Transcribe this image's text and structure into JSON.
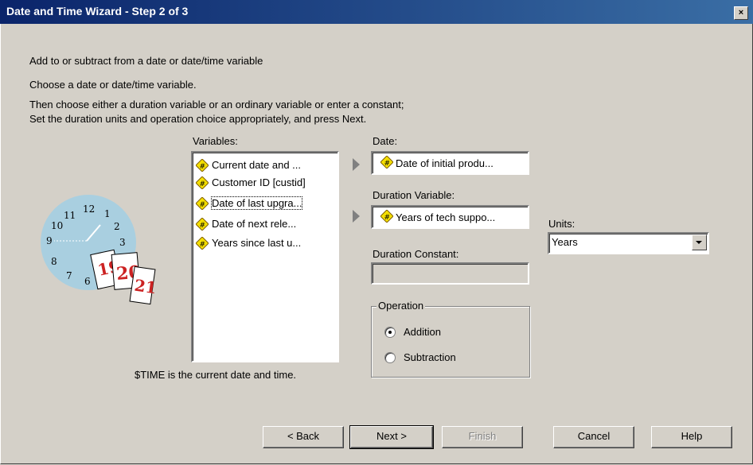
{
  "window": {
    "title": "Date and Time Wizard - Step 2 of 3",
    "close_label": "×"
  },
  "instructions": {
    "heading": "Add to or subtract from a date or date/time variable",
    "line1": "Choose a date or date/time variable.",
    "line2": "Then choose either a duration variable or an ordinary variable or enter a constant;",
    "line3": "Set the duration units and operation choice appropriately, and press Next."
  },
  "variables": {
    "label": "Variables:",
    "items": [
      {
        "label": "Current date and ..."
      },
      {
        "label": "Customer ID [custid]"
      },
      {
        "label": "Date of last upgra..."
      },
      {
        "label": "Date of next rele..."
      },
      {
        "label": "Years since last u..."
      }
    ],
    "focused_index": 2,
    "footnote": "$TIME is the current date and time."
  },
  "date_field": {
    "label": "Date:",
    "value": "Date of initial produ..."
  },
  "duration_variable": {
    "label": "Duration Variable:",
    "value": "Years of tech suppo..."
  },
  "duration_constant": {
    "label": "Duration Constant:",
    "value": ""
  },
  "units": {
    "label": "Units:",
    "selected": "Years"
  },
  "operation": {
    "legend": "Operation",
    "options": [
      {
        "label": "Addition",
        "checked": true
      },
      {
        "label": "Subtraction",
        "checked": false
      }
    ]
  },
  "buttons": {
    "back": "< Back",
    "next": "Next >",
    "finish": "Finish",
    "cancel": "Cancel",
    "help": "Help"
  },
  "illustration": {
    "clock_numbers": [
      "12",
      "1",
      "2",
      "3",
      "11",
      "10",
      "9",
      "8",
      "7",
      "6"
    ],
    "calendar_numbers": [
      "19",
      "20",
      "21"
    ]
  },
  "colors": {
    "title_bg_start": "#0a246a",
    "title_bg_end": "#3a6ea5",
    "dialog_bg": "#d4d0c8",
    "clock_face": "#a9cfe0",
    "calendar_red": "#cc2222",
    "var_icon": "#f5e000"
  }
}
